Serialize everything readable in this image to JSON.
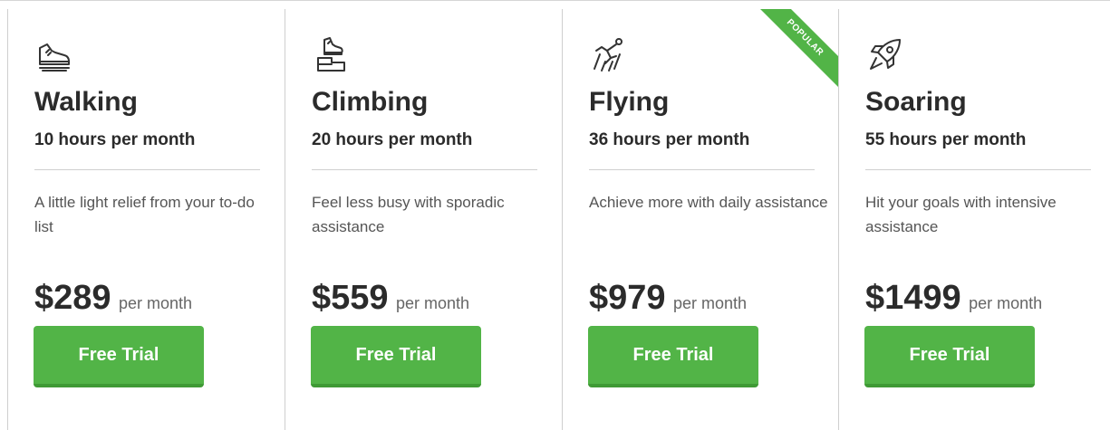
{
  "colors": {
    "accent": "#52b447",
    "accent_dark": "#3f9a35",
    "text_dark": "#2b2b2b",
    "text_muted": "#555555",
    "divider": "#cfcfcf"
  },
  "plans": [
    {
      "icon": "shoe-icon",
      "name": "Walking",
      "hours": "10 hours per month",
      "description": "A little light relief from your to-do list",
      "price": "$289",
      "period": "per month",
      "button_label": "Free Trial"
    },
    {
      "icon": "climbing-step-icon",
      "name": "Climbing",
      "hours": "20 hours per month",
      "description": "Feel less busy with sporadic assistance",
      "price": "$559",
      "period": "per month",
      "button_label": "Free Trial"
    },
    {
      "icon": "flying-hero-icon",
      "name": "Flying",
      "hours": "36 hours per month",
      "description": "Achieve more with daily assistance",
      "price": "$979",
      "period": "per month",
      "button_label": "Free Trial",
      "badge": "POPULAR"
    },
    {
      "icon": "rocket-icon",
      "name": "Soaring",
      "hours": "55 hours per month",
      "description": "Hit your goals with intensive assistance",
      "price": "$1499",
      "period": "per month",
      "button_label": "Free Trial"
    }
  ]
}
